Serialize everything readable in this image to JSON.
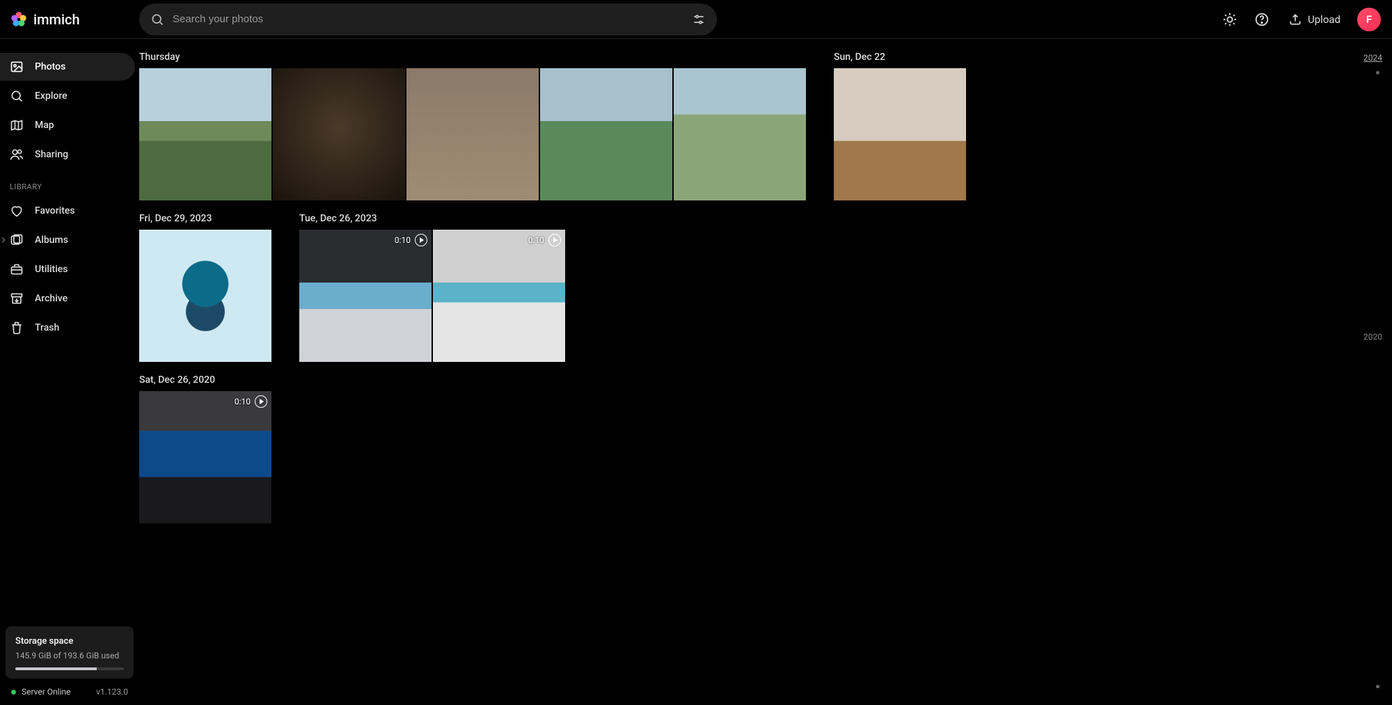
{
  "brand": {
    "name": "immich"
  },
  "search": {
    "placeholder": "Search your photos"
  },
  "header": {
    "upload_label": "Upload",
    "avatar_initial": "F"
  },
  "sidebar": {
    "items": [
      {
        "id": "photos",
        "label": "Photos",
        "icon": "image-icon",
        "selected": true
      },
      {
        "id": "explore",
        "label": "Explore",
        "icon": "search-icon"
      },
      {
        "id": "map",
        "label": "Map",
        "icon": "map-icon"
      },
      {
        "id": "sharing",
        "label": "Sharing",
        "icon": "people-icon"
      }
    ],
    "library_heading": "LIBRARY",
    "library_items": [
      {
        "id": "favorites",
        "label": "Favorites",
        "icon": "heart-icon"
      },
      {
        "id": "albums",
        "label": "Albums",
        "icon": "album-icon",
        "expandable": true
      },
      {
        "id": "utilities",
        "label": "Utilities",
        "icon": "toolbox-icon"
      },
      {
        "id": "archive",
        "label": "Archive",
        "icon": "archive-icon"
      },
      {
        "id": "trash",
        "label": "Trash",
        "icon": "trash-icon"
      }
    ],
    "storage": {
      "title": "Storage space",
      "subtitle": "145.9 GiB of 193.6 GiB used",
      "used_pct": 75
    },
    "status_text": "Server Online",
    "version": "v1.123.0"
  },
  "timeline": {
    "years": [
      {
        "label": "2024",
        "active": true
      },
      {
        "label": "2020"
      }
    ]
  },
  "groups": [
    {
      "row": 0,
      "title": "Thursday",
      "thumbs": [
        {
          "cls": "t-house"
        },
        {
          "cls": "t-store"
        },
        {
          "cls": "t-phone"
        },
        {
          "cls": "t-office1"
        },
        {
          "cls": "t-office2"
        }
      ]
    },
    {
      "row": 0,
      "title": "Sun, Dec 22",
      "thumbs": [
        {
          "cls": "t-kitchen"
        }
      ]
    },
    {
      "row": 1,
      "title": "Fri, Dec 29, 2023",
      "thumbs": [
        {
          "cls": "t-cloud"
        }
      ]
    },
    {
      "row": 1,
      "title": "Tue, Dec 26, 2023",
      "thumbs": [
        {
          "cls": "t-vid1",
          "duration": "0:10"
        },
        {
          "cls": "t-vid2",
          "duration": "0:10"
        }
      ]
    },
    {
      "row": 2,
      "title": "Sat, Dec 26, 2020",
      "thumbs": [
        {
          "cls": "t-vid3",
          "duration": "0:10"
        }
      ]
    }
  ]
}
